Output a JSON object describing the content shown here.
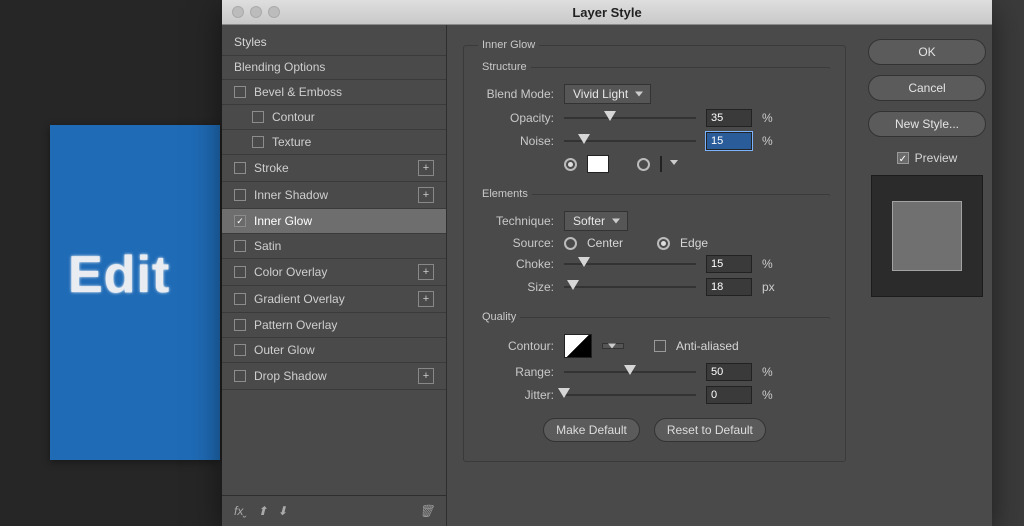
{
  "canvas_text": "Edit",
  "dialog": {
    "title": "Layer Style",
    "styles_header": "Styles",
    "blending_options_label": "Blending Options",
    "effects": {
      "bevel_emboss": "Bevel & Emboss",
      "contour": "Contour",
      "texture": "Texture",
      "stroke": "Stroke",
      "inner_shadow": "Inner Shadow",
      "inner_glow": "Inner Glow",
      "satin": "Satin",
      "color_overlay": "Color Overlay",
      "gradient_overlay": "Gradient Overlay",
      "pattern_overlay": "Pattern Overlay",
      "outer_glow": "Outer Glow",
      "drop_shadow": "Drop Shadow"
    },
    "section": {
      "inner_glow": "Inner Glow",
      "structure": "Structure",
      "elements": "Elements",
      "quality": "Quality"
    },
    "labels": {
      "blend_mode": "Blend Mode:",
      "opacity": "Opacity:",
      "noise": "Noise:",
      "technique": "Technique:",
      "source": "Source:",
      "center": "Center",
      "edge": "Edge",
      "choke": "Choke:",
      "size": "Size:",
      "contour": "Contour:",
      "anti_aliased": "Anti-aliased",
      "range": "Range:",
      "jitter": "Jitter:",
      "make_default": "Make Default",
      "reset_default": "Reset to Default",
      "percent": "%",
      "px": "px"
    },
    "values": {
      "blend_mode": "Vivid Light",
      "opacity": "35",
      "noise": "15",
      "technique": "Softer",
      "choke": "15",
      "size": "18",
      "range": "50",
      "jitter": "0"
    },
    "buttons": {
      "ok": "OK",
      "cancel": "Cancel",
      "new_style": "New Style...",
      "preview": "Preview"
    },
    "fx_label": "fx"
  }
}
